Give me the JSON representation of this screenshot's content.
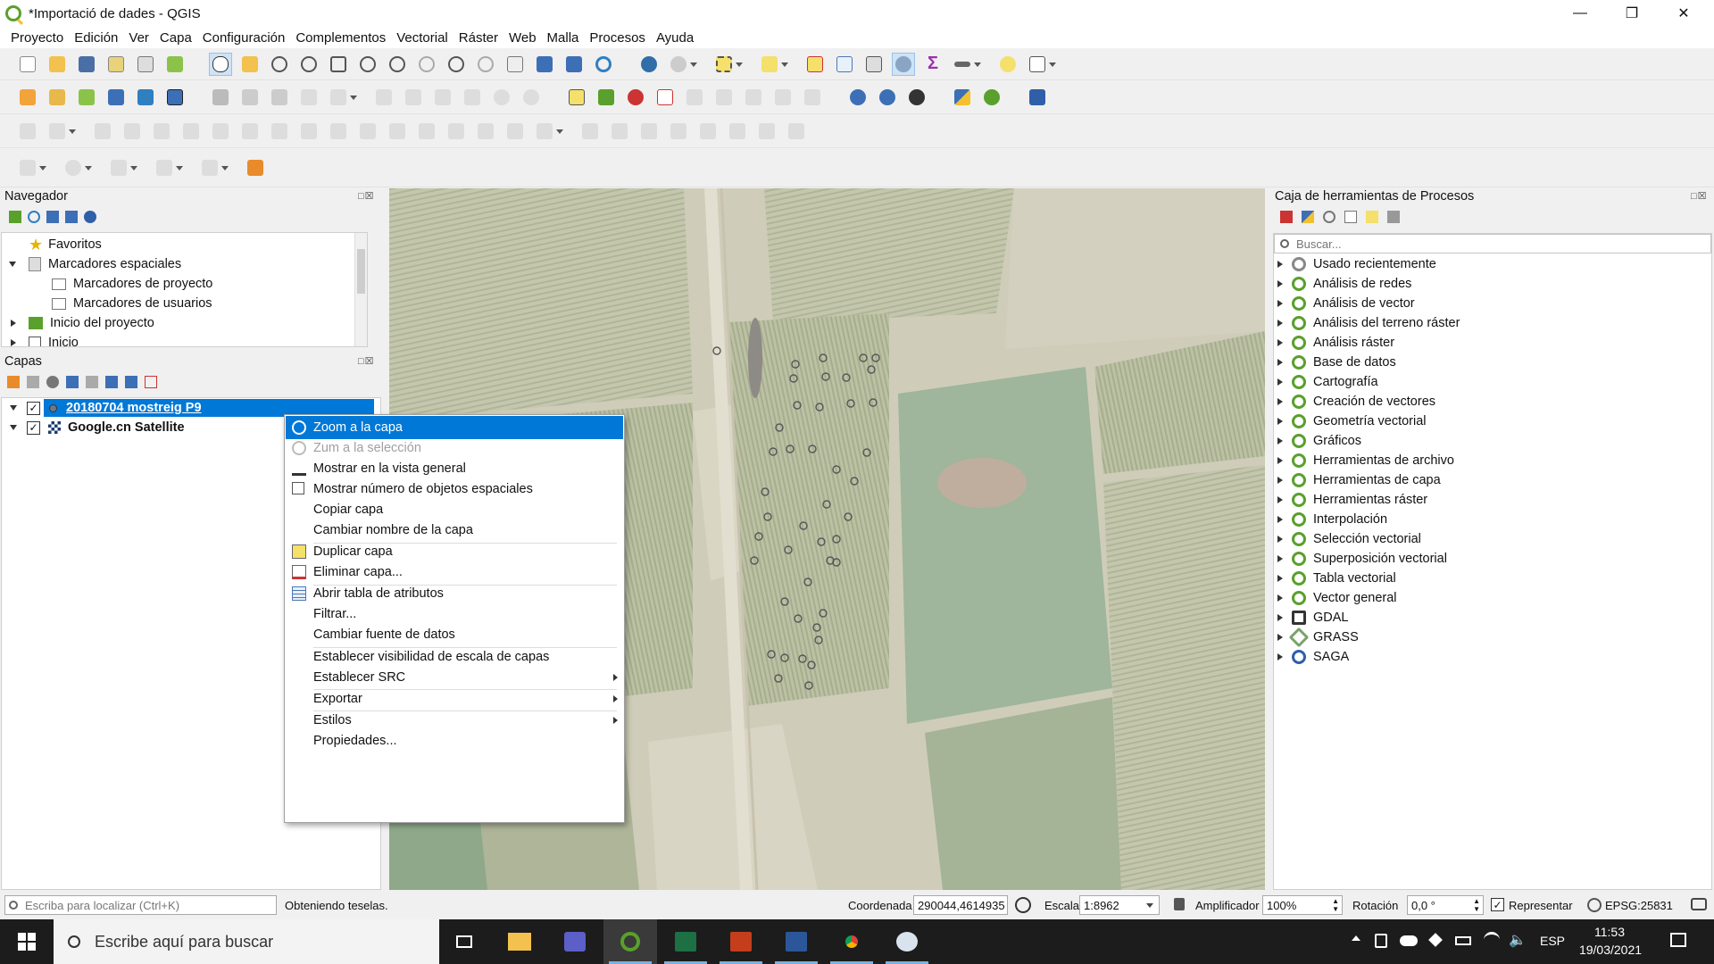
{
  "window": {
    "title": "*Importació de dades - QGIS"
  },
  "menu": [
    "Proyecto",
    "Edición",
    "Ver",
    "Capa",
    "Configuración",
    "Complementos",
    "Vectorial",
    "Ráster",
    "Web",
    "Malla",
    "Procesos",
    "Ayuda"
  ],
  "navigator": {
    "title": "Navegador",
    "items": {
      "favorites": "Favoritos",
      "spatial_bookmarks": "Marcadores espaciales",
      "project_bookmarks": "Marcadores de proyecto",
      "user_bookmarks": "Marcadores de usuarios",
      "project_home": "Inicio del proyecto",
      "home": "Inicio"
    }
  },
  "layers": {
    "title": "Capas",
    "items": [
      "20180704 mostreig P9",
      "Google.cn Satellite"
    ]
  },
  "context_menu": [
    {
      "label": "Zoom a la capa",
      "state": "selected"
    },
    {
      "label": "Zum a la selección",
      "state": "disabled"
    },
    {
      "label": "Mostrar en la vista general",
      "state": "normal"
    },
    {
      "label": "Mostrar número de objetos espaciales",
      "state": "normal"
    },
    {
      "label": "Copiar capa",
      "state": "normal"
    },
    {
      "label": "Cambiar nombre de la capa",
      "state": "normal"
    },
    {
      "label": "Duplicar capa",
      "state": "normal"
    },
    {
      "label": "Eliminar capa...",
      "state": "normal"
    },
    {
      "label": "Abrir tabla de atributos",
      "state": "normal"
    },
    {
      "label": "Filtrar...",
      "state": "normal"
    },
    {
      "label": "Cambiar fuente de datos",
      "state": "normal"
    },
    {
      "label": "Establecer visibilidad de escala de capas",
      "state": "normal"
    },
    {
      "label": "Establecer SRC",
      "state": "submenu"
    },
    {
      "label": "Exportar",
      "state": "submenu"
    },
    {
      "label": "Estilos",
      "state": "submenu"
    },
    {
      "label": "Propiedades...",
      "state": "normal"
    }
  ],
  "processing": {
    "title": "Caja de herramientas de Procesos",
    "search_placeholder": "Buscar...",
    "items": [
      "Usado recientemente",
      "Análisis de redes",
      "Análisis de vector",
      "Análisis del terreno ráster",
      "Análisis ráster",
      "Base de datos",
      "Cartografía",
      "Creación de vectores",
      "Geometría vectorial",
      "Gráficos",
      "Herramientas de archivo",
      "Herramientas de capa",
      "Herramientas ráster",
      "Interpolación",
      "Selección vectorial",
      "Superposición vectorial",
      "Tabla vectorial",
      "Vector general",
      "GDAL",
      "GRASS",
      "SAGA"
    ]
  },
  "statusbar": {
    "locator_placeholder": "Escriba para localizar (Ctrl+K)",
    "message": "Obteniendo teselas.",
    "coord_label": "Coordenada",
    "coord_value": "290044,4614935",
    "scale_label": "Escala",
    "scale_value": "1:8962",
    "magnifier_label": "Amplificador",
    "magnifier_value": "100%",
    "rotation_label": "Rotación",
    "rotation_value": "0,0 °",
    "render_label": "Representar",
    "crs": "EPSG:25831"
  },
  "taskbar": {
    "search_placeholder": "Escribe aquí para buscar",
    "lang": "ESP",
    "time": "11:53",
    "date": "19/03/2021"
  },
  "colors": {
    "selection": "#0078d7",
    "qgis_green": "#5aa02c",
    "taskbar": "#1c1c1c"
  }
}
